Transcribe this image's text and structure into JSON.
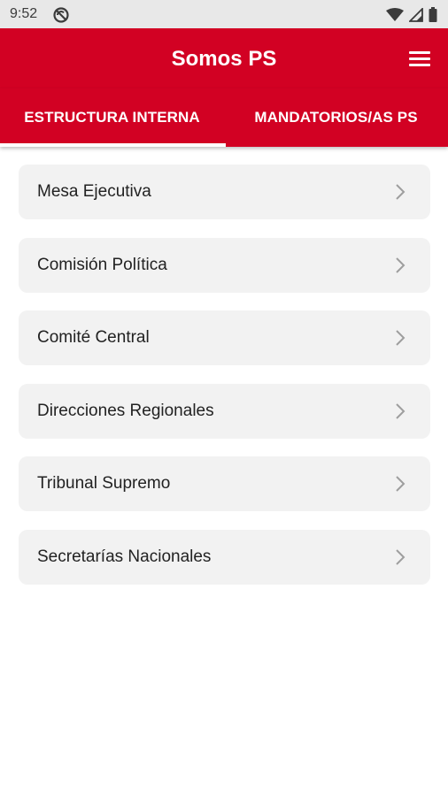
{
  "status_bar": {
    "time": "9:52"
  },
  "app_bar": {
    "title": "Somos PS"
  },
  "tabs": [
    {
      "label": "ESTRUCTURA INTERNA",
      "selected": true
    },
    {
      "label": "MANDATORIOS/AS PS",
      "selected": false
    }
  ],
  "list": {
    "items": [
      {
        "label": "Mesa Ejecutiva"
      },
      {
        "label": "Comisión Política"
      },
      {
        "label": "Comité Central"
      },
      {
        "label": "Direcciones Regionales"
      },
      {
        "label": "Tribunal Supremo"
      },
      {
        "label": "Secretarías Nacionales"
      }
    ]
  },
  "colors": {
    "brand_red": "#d20123",
    "card_bg": "#f2f2f2",
    "status_bar_bg": "#e8e8e8"
  }
}
